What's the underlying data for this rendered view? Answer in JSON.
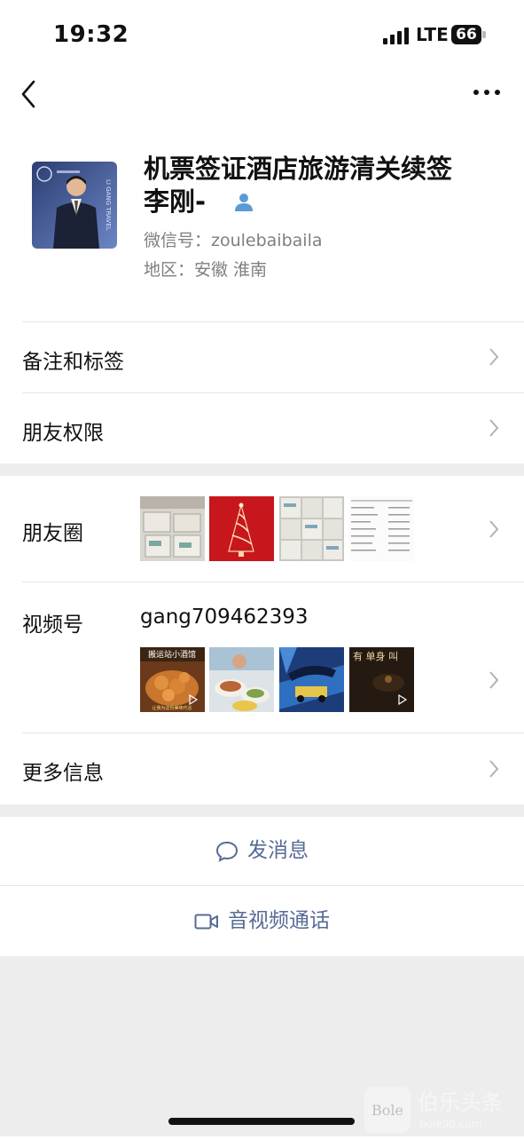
{
  "status": {
    "time": "19:32",
    "network": "LTE",
    "battery": "66"
  },
  "nav": {
    "back_icon": "chevron-left-icon",
    "more_icon": "more-dots-icon"
  },
  "profile": {
    "name_line1": "机票签证酒店旅游清关续签",
    "name_line2": "李刚-",
    "wechat_id": "微信号：zoulebaibaila",
    "region": "地区：安徽 淮南",
    "verified_icon": "contact-person-icon",
    "avatar_text": "LI GANG TRAVEL"
  },
  "menu": {
    "remark_tags": "备注和标签",
    "friend_permissions": "朋友权限",
    "moments": "朋友圈",
    "channels": "视频号",
    "channels_id": "gang709462393",
    "more_info": "更多信息"
  },
  "moments_thumbs": [
    "moments-photo-boxes",
    "moments-photo-christmas-tree",
    "moments-photo-documents",
    "moments-photo-table"
  ],
  "channel_thumbs": [
    {
      "name": "channel-video-food",
      "caption": "搬运站小酒馆",
      "sub": "让我为这份美味代言"
    },
    {
      "name": "channel-video-meal",
      "caption": "",
      "sub": ""
    },
    {
      "name": "channel-video-poster",
      "caption": "",
      "sub": ""
    },
    {
      "name": "channel-video-night",
      "caption": "有 单身 叫",
      "sub": ""
    }
  ],
  "actions": {
    "send_message": "发消息",
    "av_call": "音视频通话"
  },
  "watermark": {
    "brand": "Bole",
    "site": "bole90.com",
    "title": "伯乐头条"
  },
  "colors": {
    "link": "#576b95",
    "gray_text": "#7f7f7f",
    "section_gap": "#ededed",
    "contact_icon": "#5b9bd5"
  }
}
